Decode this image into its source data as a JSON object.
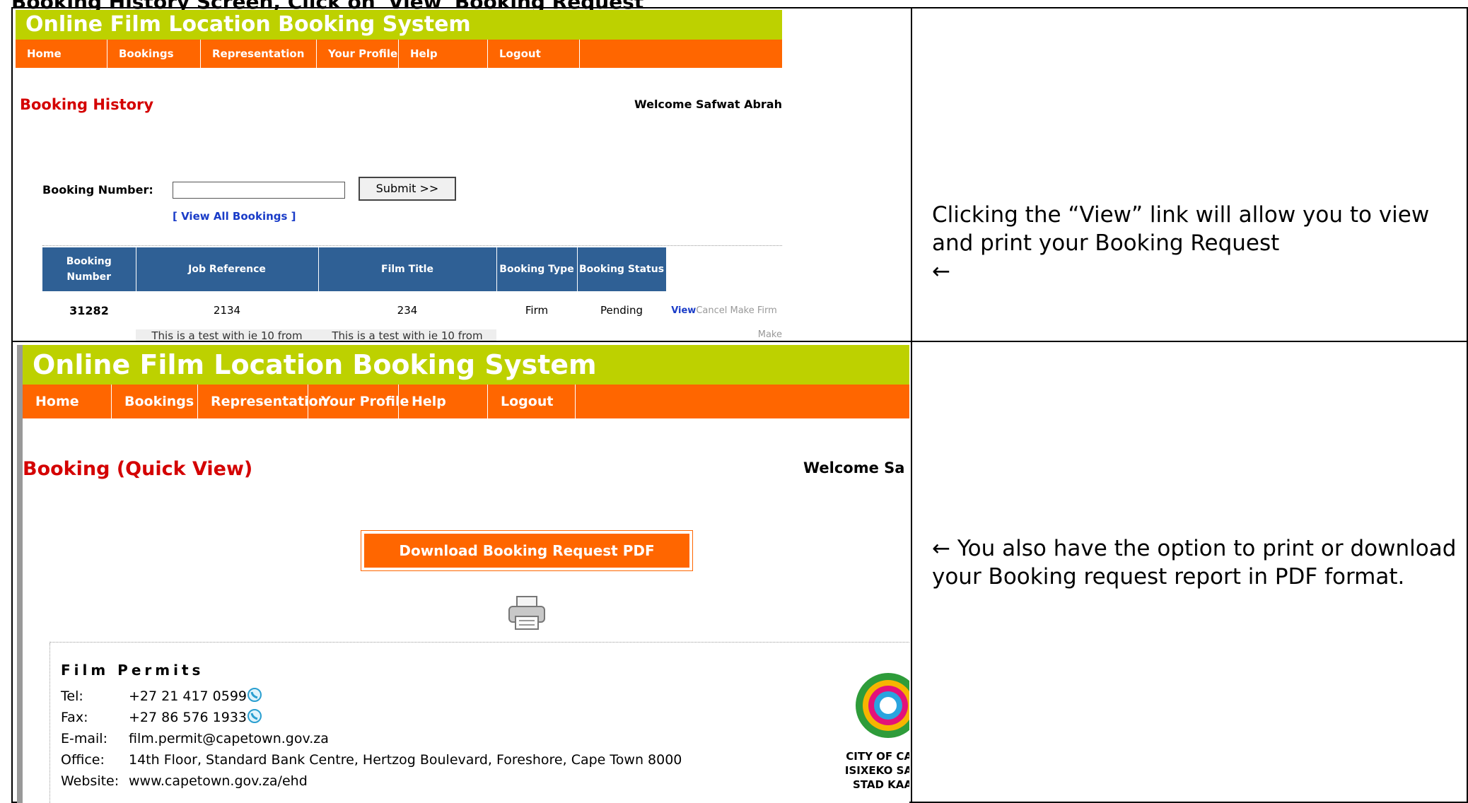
{
  "document": {
    "top_heading": "Booking History Screen, Click on 'View' Booking Request"
  },
  "screenshot1": {
    "app_title": "Online Film Location Booking System",
    "nav": [
      "Home",
      "Bookings",
      "Representation",
      "Your Profile",
      "Help",
      "Logout"
    ],
    "page_heading": "Booking History",
    "welcome": "Welcome Safwat Abrah",
    "booking_number_label": "Booking Number:",
    "submit_label": "Submit >>",
    "view_all_link": "[ View All Bookings ]",
    "table": {
      "headers": [
        "Booking Number",
        "Job Reference",
        "Film Title",
        "Booking Type",
        "Booking Status"
      ],
      "rows": [
        {
          "booking_number": "31282",
          "job_reference": "2134",
          "film_title": "234",
          "booking_type": "Firm",
          "booking_status": "Pending",
          "view": "View",
          "cancel": "Cancel",
          "make_firm": "Make Firm"
        },
        {
          "booking_number": "",
          "job_reference": "This is a test with ie 10 from",
          "film_title": "This is a test with ie 10 from",
          "booking_type": "",
          "booking_status": "",
          "make_firm": "Make"
        }
      ]
    }
  },
  "note1": "Clicking the “View” link will allow you to view and print your Booking Request",
  "note1_arrow": "←",
  "screenshot2": {
    "app_title": "Online Film Location Booking System",
    "nav": [
      "Home",
      "Bookings",
      "Representation",
      "Your Profile",
      "Help",
      "Logout"
    ],
    "page_heading": "Booking (Quick View)",
    "welcome": "Welcome Sa",
    "pdf_button": "Download Booking Request PDF",
    "org_name": "Film Permits",
    "contact": {
      "tel_label": "Tel:",
      "tel": "+27 21 417 0599",
      "fax_label": "Fax:",
      "fax": "+27 86 576 1933",
      "email_label": "E-mail:",
      "email": "film.permit@capetown.gov.za",
      "office_label": "Office:",
      "office": "14th Floor, Standard Bank Centre, Hertzog Boulevard, Foreshore, Cape Town 8000",
      "website_label": "Website:",
      "website": "www.capetown.gov.za/ehd"
    },
    "city_lines": [
      "CITY OF CA",
      "ISIXEKO SA",
      "STAD KAA"
    ]
  },
  "note2_arrow": "←",
  "note2": "You also have the option to print or download your Booking request report in PDF format.",
  "colors": {
    "brand_green": "#bdd100",
    "nav_orange": "#ff6600",
    "heading_red": "#d40000",
    "table_header_blue": "#2f6095",
    "link_blue": "#1a3cc8"
  },
  "icons": [
    "printer-icon",
    "phone-icon",
    "city-logo-icon"
  ]
}
